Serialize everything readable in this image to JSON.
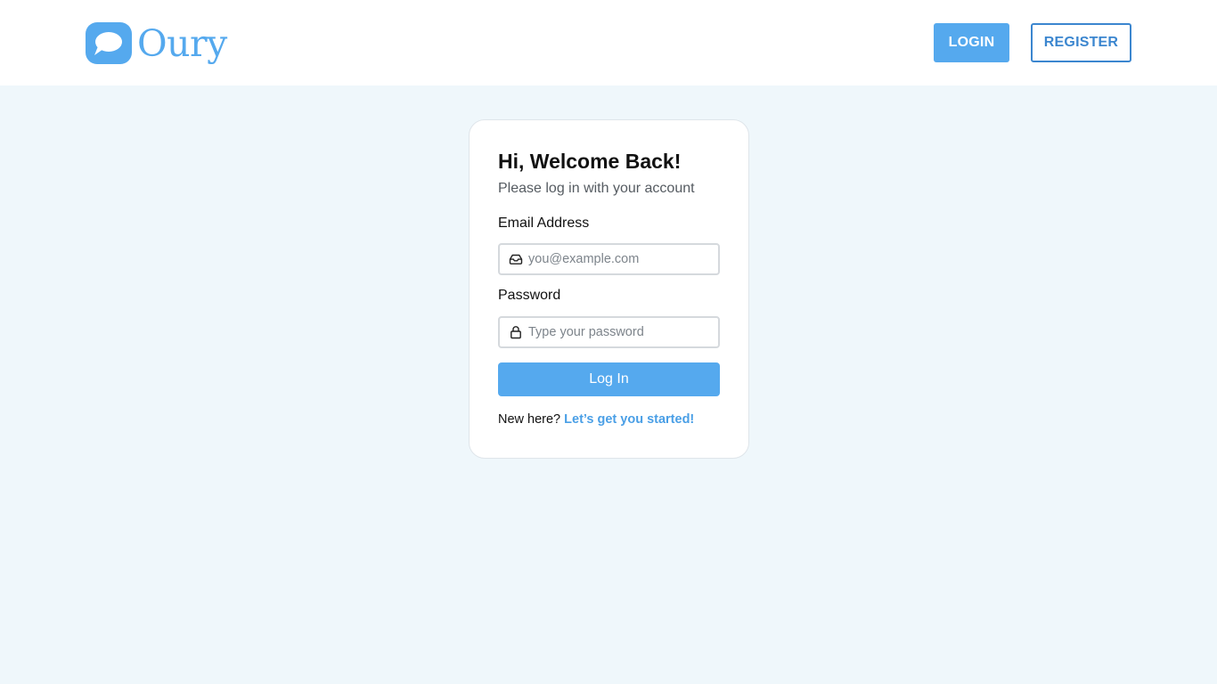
{
  "brand": {
    "name": "Oury",
    "logo_icon": "chat-bubble-icon",
    "color": "#55a9ee"
  },
  "nav": {
    "login_label": "LOGIN",
    "register_label": "REGISTER"
  },
  "login_card": {
    "title": "Hi, Welcome Back!",
    "subtitle": "Please log in with your account",
    "email": {
      "label": "Email Address",
      "placeholder": "you@example.com",
      "value": "",
      "icon": "inbox-icon"
    },
    "password": {
      "label": "Password",
      "placeholder": "Type your password",
      "value": "",
      "icon": "lock-icon"
    },
    "submit_label": "Log In",
    "signup_prompt": "New here?",
    "signup_link": "Let’s get you started!"
  },
  "colors": {
    "accent": "#55a9ee",
    "register_border": "#3b86cf",
    "page_background": "#eff7fb",
    "header_background": "#ffffff"
  }
}
